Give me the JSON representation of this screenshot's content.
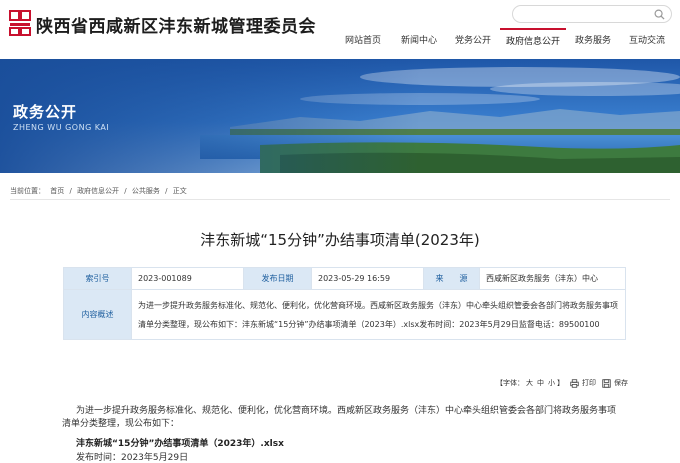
{
  "header": {
    "site_title": "陕西省西咸新区沣东新城管理委员会",
    "search_placeholder": ""
  },
  "nav": {
    "items": [
      "网站首页",
      "新闻中心",
      "党务公开",
      "政府信息公开",
      "政务服务",
      "互动交流"
    ],
    "active": "政府信息公开"
  },
  "banner": {
    "title": "政务公开",
    "subtitle": "ZHENG WU GONG KAI"
  },
  "breadcrumb": {
    "prefix": "当前位置：",
    "items": [
      "首页",
      "/",
      "政府信息公开",
      "/",
      "公共服务",
      "/",
      "正文"
    ]
  },
  "article": {
    "title": "沣东新城“15分钟”办结事项清单(2023年)",
    "info": {
      "index_label": "索引号",
      "index_value": "2023-001089",
      "date_label": "发布日期",
      "date_value": "2023-05-29 16:59",
      "source_label": "来　　源",
      "source_value": "西咸新区政务服务（沣东）中心",
      "summary_label": "内容概述",
      "summary_line1": "为进一步提升政务服务标准化、规范化、便利化，优化营商环境。西咸新区政务服务（沣东）中心牵头组织管委会各部门将政务服务事项",
      "summary_line2": "清单分类整理，现公布如下：沣东新城“15分钟”办结事项清单（2023年）.xlsx发布时间：2023年5月29日监督电话：89500100"
    },
    "tools": {
      "font_label": "【字体：",
      "font_large": "大",
      "font_medium": "中",
      "font_small": "小",
      "font_end": "】",
      "print_label": "打印",
      "save_label": "保存"
    },
    "body_line1": "为进一步提升政务服务标准化、规范化、便利化，优化营商环境。西咸新区政务服务（沣东）中心牵头组织管委会各部门将政务服务事项",
    "body_line2": "清单分类整理，现公布如下：",
    "file_link": "沣东新城“15分钟”办结事项清单（2023年）.xlsx",
    "pub_time": "发布时间：2023年5月29日"
  },
  "colors": {
    "accent": "#c8102e",
    "label_bg": "#dbe8f5",
    "label_text": "#1f5f9f"
  }
}
